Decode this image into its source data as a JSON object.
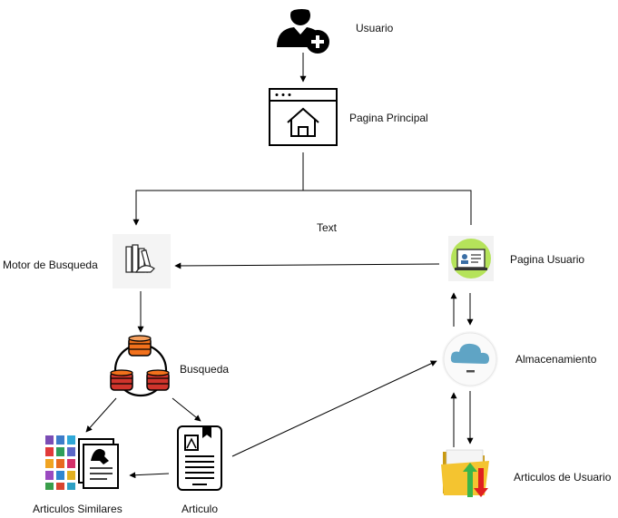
{
  "diagram": {
    "labels": {
      "usuario": "Usuario",
      "pagina_principal": "Pagina Principal",
      "text": "Text",
      "motor_busqueda": "Motor de Busqueda",
      "pagina_usuario": "Pagina Usuario",
      "busqueda": "Busqueda",
      "almacenamiento": "Almacenamiento",
      "articulos_similares": "Articulos Similares",
      "articulo": "Articulo",
      "articulos_usuario": "Articulos de Usuario"
    },
    "icons": {
      "usuario": "add-user-icon",
      "pagina_principal": "browser-home-icon",
      "motor_busqueda": "library-books-icon",
      "pagina_usuario": "user-profile-screen-icon",
      "busqueda": "database-network-icon",
      "almacenamiento": "cloud-storage-icon",
      "articulos_similares": "articles-grid-icon",
      "articulo": "ebook-reader-icon",
      "articulos_usuario": "folder-transfer-icon"
    },
    "colors": {
      "line": "#000000",
      "db_orange": "#f2711c",
      "db_red": "#d0342c",
      "cloud_blue": "#5fa4c5",
      "user_green": "#b5e35a",
      "folder_yellow": "#f4c430"
    }
  }
}
